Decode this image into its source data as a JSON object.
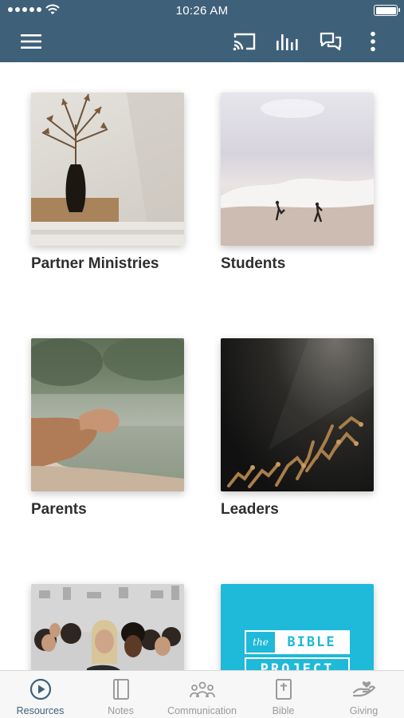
{
  "status_bar": {
    "time": "10:26 AM"
  },
  "app_bar": {
    "icons": [
      "menu-icon",
      "cast-icon",
      "audio-bars-icon",
      "chat-icon",
      "more-vertical-icon"
    ]
  },
  "tiles": [
    {
      "label": "Partner Ministries",
      "image": "vase-plant-photo"
    },
    {
      "label": "Students",
      "image": "beach-waves-photo"
    },
    {
      "label": "Parents",
      "image": "clasped-hands-photo"
    },
    {
      "label": "Leaders",
      "image": "raised-hands-photo"
    },
    {
      "label": "",
      "image": "youth-crowd-photo"
    },
    {
      "label": "",
      "image": "bible-project-logo",
      "logo_text": {
        "top": "the",
        "main": "BIBLE",
        "sub": "PROJECT"
      }
    }
  ],
  "tab_bar": {
    "active": "Resources",
    "tabs": [
      {
        "label": "Resources",
        "icon": "play-circle-icon"
      },
      {
        "label": "Notes",
        "icon": "notebook-icon"
      },
      {
        "label": "Communication",
        "icon": "group-icon"
      },
      {
        "label": "Bible",
        "icon": "bible-icon"
      },
      {
        "label": "Giving",
        "icon": "giving-hand-icon"
      }
    ]
  },
  "colors": {
    "header": "#3f6079",
    "accent": "#3f6079",
    "tab_inactive": "#9a9a9a",
    "bible_project_bg": "#1fb9d9"
  }
}
